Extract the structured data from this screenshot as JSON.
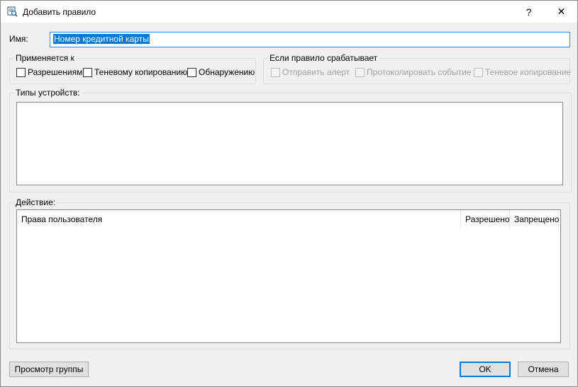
{
  "window": {
    "title": "Добавить правило",
    "help_glyph": "?",
    "close_glyph": "✕"
  },
  "name": {
    "label": "Имя:",
    "value": "Номер кредитной карты"
  },
  "applies_to": {
    "legend": "Применяется к",
    "options": [
      {
        "label": "Разрешениям",
        "checked": false
      },
      {
        "label": "Теневому копированию",
        "checked": false
      },
      {
        "label": "Обнаружению",
        "checked": false
      }
    ]
  },
  "on_trigger": {
    "legend": "Если правило срабатывает",
    "options": [
      {
        "label": "Отправить алерт",
        "checked": false,
        "disabled": true
      },
      {
        "label": "Протоколировать событие",
        "checked": false,
        "disabled": true
      },
      {
        "label": "Теневое копирование",
        "checked": false,
        "disabled": true
      }
    ]
  },
  "device_types": {
    "legend": "Типы устройств:"
  },
  "action": {
    "legend": "Действие:",
    "columns": [
      "Права пользователя",
      "Разрешено",
      "Запрещено"
    ]
  },
  "buttons": {
    "view_group": "Просмотр группы",
    "ok": "OK",
    "cancel": "Отмена"
  },
  "colors": {
    "accent": "#0078d7",
    "selection_bg": "#0078d7"
  }
}
